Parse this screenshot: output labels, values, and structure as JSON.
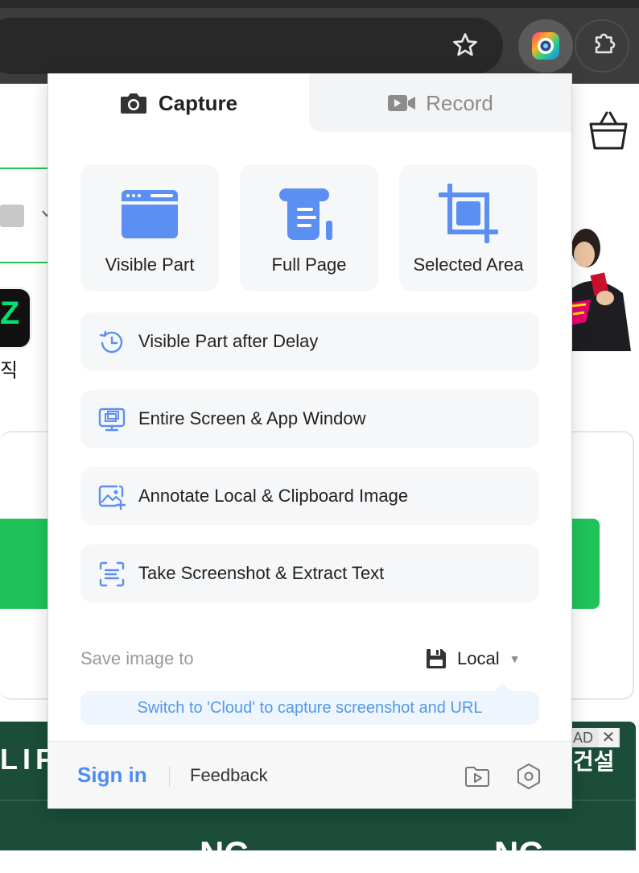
{
  "tabs": {
    "capture": "Capture",
    "record": "Record"
  },
  "tiles": [
    {
      "label": "Visible Part",
      "icon": "browser-window-icon"
    },
    {
      "label": "Full Page",
      "icon": "scroll-page-icon"
    },
    {
      "label": "Selected Area",
      "icon": "crop-icon"
    }
  ],
  "options": [
    {
      "label": "Visible Part after Delay",
      "icon": "clock-delay-icon"
    },
    {
      "label": "Entire Screen & App Window",
      "icon": "monitor-windows-icon"
    },
    {
      "label": "Annotate Local & Clipboard Image",
      "icon": "image-plus-icon"
    },
    {
      "label": "Take Screenshot & Extract Text",
      "icon": "text-scan-icon"
    }
  ],
  "save": {
    "label": "Save image to",
    "destination": "Local",
    "hint": "Switch to 'Cloud' to capture screenshot and URL"
  },
  "footer": {
    "sign_in": "Sign in",
    "feedback": "Feedback"
  },
  "background": {
    "korean_text": "직",
    "ad_text_left": "LIF",
    "ad_badge": "AD",
    "ad_close": "✕",
    "ad_text_right": "건설",
    "ad_bottom_left": "NC",
    "ad_bottom_right": "NC"
  },
  "colors": {
    "accent_blue": "#4a8ef0",
    "icon_blue": "#5b8ff2",
    "tile_bg": "#f6f7f9",
    "hint_bg": "#eef5fd"
  }
}
